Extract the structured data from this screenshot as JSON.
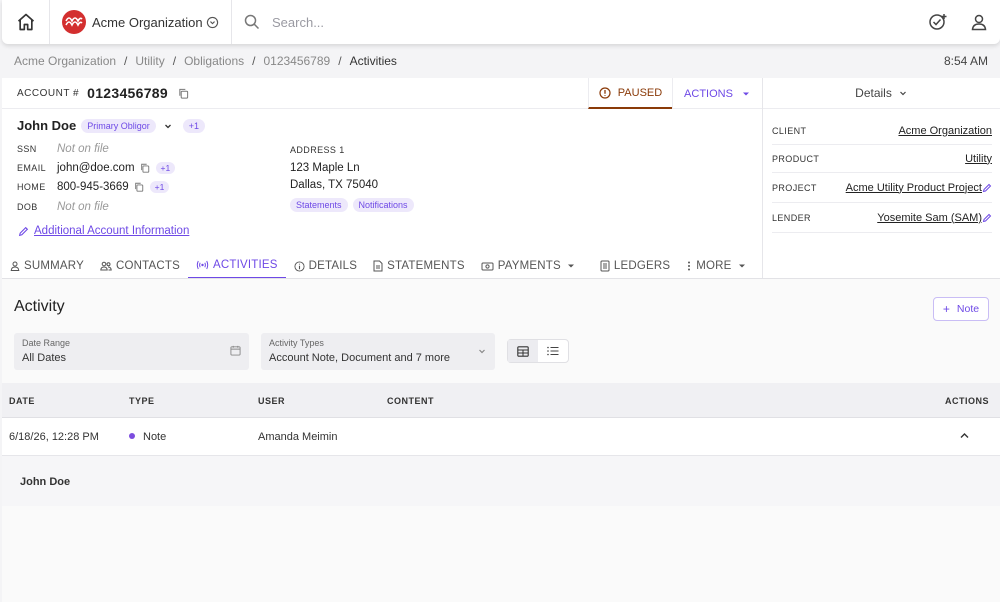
{
  "topbar": {
    "org_name": "Acme Organization",
    "search_placeholder": "Search..."
  },
  "breadcrumb": {
    "items": [
      "Acme Organization",
      "Utility",
      "Obligations",
      "0123456789",
      "Activities"
    ],
    "time": "8:54 AM"
  },
  "account": {
    "label": "ACCOUNT #",
    "number": "0123456789",
    "status": "PAUSED",
    "actions_label": "ACTIONS"
  },
  "person": {
    "name": "John Doe",
    "role": "Primary Obligor",
    "extra": "+1",
    "fields": {
      "ssn_label": "SSN",
      "ssn_value": "Not on file",
      "email_label": "EMAIL",
      "email_value": "john@doe.com",
      "email_extra": "+1",
      "home_label": "HOME",
      "home_value": "800-945-3669",
      "home_extra": "+1",
      "dob_label": "DOB",
      "dob_value": "Not on file"
    },
    "address_label": "ADDRESS 1",
    "address_line1": "123 Maple Ln",
    "address_line2": "Dallas, TX 75040",
    "tags": [
      "Statements",
      "Notifications"
    ],
    "more_link": "Additional Account Information"
  },
  "details": {
    "header": "Details",
    "rows": [
      {
        "key": "CLIENT",
        "value": "Acme Organization"
      },
      {
        "key": "PRODUCT",
        "value": "Utility"
      },
      {
        "key": "PROJECT",
        "value": "Acme Utility Product Project"
      },
      {
        "key": "LENDER",
        "value": "Yosemite Sam (SAM)"
      }
    ]
  },
  "tabs": [
    "SUMMARY",
    "CONTACTS",
    "ACTIVITIES",
    "DETAILS",
    "STATEMENTS",
    "PAYMENTS",
    "LEDGERS",
    "MORE"
  ],
  "activity": {
    "title": "Activity",
    "note_button": "Note",
    "date_range_label": "Date Range",
    "date_range_value": "All Dates",
    "types_label": "Activity Types",
    "types_value": "Account Note, Document and 7 more",
    "columns": [
      "DATE",
      "TYPE",
      "USER",
      "CONTENT",
      "ACTIONS"
    ],
    "rows": [
      {
        "date": "6/18/26, 12:28 PM",
        "type": "Note",
        "user": "Amanda Meimin",
        "content": ""
      }
    ],
    "expanded_name": "John Doe"
  },
  "colors": {
    "accent": "#6e49e6",
    "paused": "#8a3a08",
    "logo": "#d32f2f"
  }
}
